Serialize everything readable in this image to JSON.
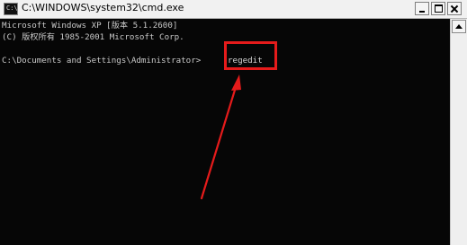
{
  "window": {
    "title": "C:\\WINDOWS\\system32\\cmd.exe",
    "icon_label": "C:\\",
    "icon": "cmd-icon",
    "controls": [
      "minimize-icon",
      "maximize-icon",
      "close-icon"
    ]
  },
  "console": {
    "lines": [
      "Microsoft Windows XP [版本 5.1.2600]",
      "(C) 版权所有 1985-2001 Microsoft Corp.",
      "C:\\Documents and Settings\\Administrator>"
    ],
    "command": "regedit"
  },
  "annotation": {
    "color": "#e51b1b"
  },
  "colors": {
    "console_bg": "#060606",
    "console_text": "#c9c9c9"
  }
}
